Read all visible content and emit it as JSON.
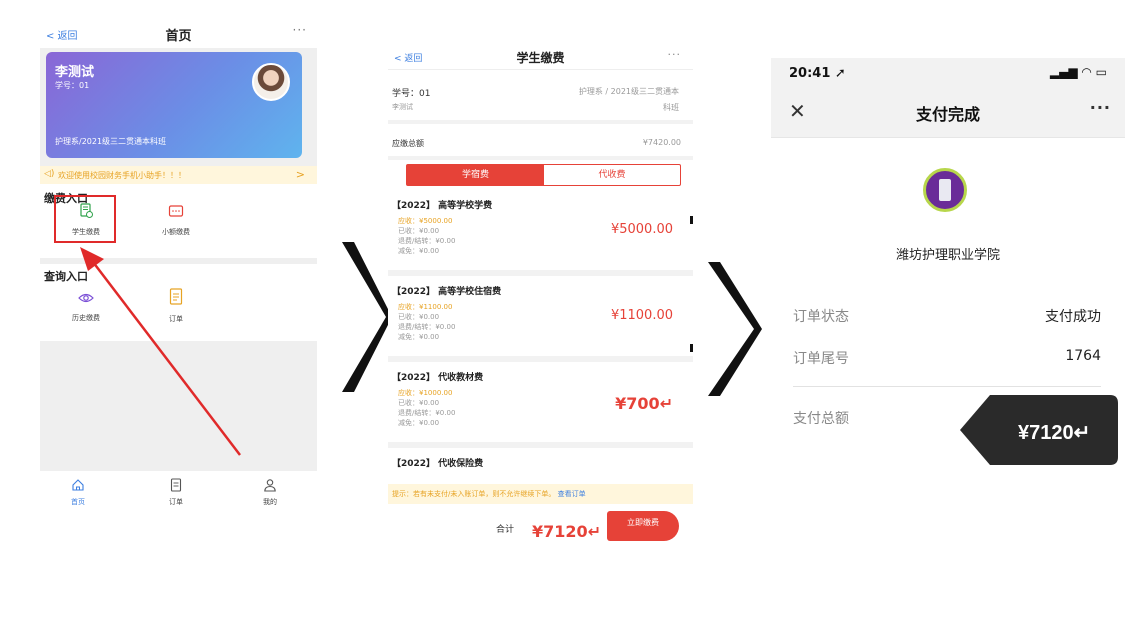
{
  "screen1": {
    "nav": {
      "back": "< 返回",
      "title": "首页",
      "more": "···"
    },
    "student_card": {
      "name": "李测试",
      "student_id": "学号：01",
      "class": "护理系/2021级三二贯通本科班"
    },
    "notice": {
      "text": "欢迎使用校园财务手机小助手！！！",
      "arrow": ">"
    },
    "payment_section": {
      "title": "缴费入口",
      "items": [
        {
          "label": "学生缴费",
          "icon": "document-icon"
        },
        {
          "label": "小额缴费",
          "icon": "message-icon"
        }
      ]
    },
    "query_section": {
      "title": "查询入口",
      "items": [
        {
          "label": "历史缴费",
          "icon": "eye-icon"
        },
        {
          "label": "订单",
          "icon": "list-icon"
        }
      ]
    },
    "tabbar": [
      {
        "label": "首页",
        "icon": "home-icon"
      },
      {
        "label": "订单",
        "icon": "order-icon"
      },
      {
        "label": "我的",
        "icon": "user-icon"
      }
    ]
  },
  "screen2": {
    "nav": {
      "back": "< 返回",
      "title": "学生缴费",
      "more": "···"
    },
    "student": {
      "id": "学号：01",
      "dept": "护理系 / 2021级三二贯通本",
      "dept2": "科班",
      "name": "李测试"
    },
    "total_due": {
      "label": "应缴总额",
      "value": "¥7420.00"
    },
    "tabs": [
      "学宿费",
      "代收费"
    ],
    "fees": [
      {
        "title": "【2022】 高等学校学费",
        "due": "应收：¥5000.00",
        "paid": "已收：¥0.00",
        "refund": "退费/结转：¥0.00",
        "reduce": "减免：¥0.00",
        "amount": "¥5000.00"
      },
      {
        "title": "【2022】 高等学校住宿费",
        "due": "应收：¥1100.00",
        "paid": "已收：¥0.00",
        "refund": "退费/结转：¥0.00",
        "reduce": "减免：¥0.00",
        "amount": "¥1100.00"
      },
      {
        "title": "【2022】 代收教材费",
        "due": "应收：¥1000.00",
        "paid": "已收：¥0.00",
        "refund": "退费/结转：¥0.00",
        "reduce": "减免：¥0.00",
        "amount": "¥700↵"
      },
      {
        "title": "【2022】 代收保险费"
      }
    ],
    "tip": {
      "text": "提示：若有未支付/未入账订单，则不允许继续下单。",
      "link": "查看订单"
    },
    "footer": {
      "total_label": "合计",
      "total_value": "¥7120↵",
      "pay_button": "立即缴费"
    }
  },
  "screen3": {
    "status": {
      "time": "20:41 ➚",
      "icons": "▂▄▆ ◠ ▭"
    },
    "nav": {
      "close": "✕",
      "title": "支付完成",
      "more": "···"
    },
    "school": "潍坊护理职业学院",
    "rows": [
      {
        "label": "订单状态",
        "value": "支付成功"
      },
      {
        "label": "订单尾号",
        "value": "1764"
      }
    ],
    "amount": {
      "label": "支付总额",
      "value": "¥7120↵"
    }
  },
  "colors": {
    "accent_red": "#e64238",
    "link_blue": "#3d7fe0",
    "warning": "#e7a324",
    "annotation_red": "#e02a2a"
  }
}
